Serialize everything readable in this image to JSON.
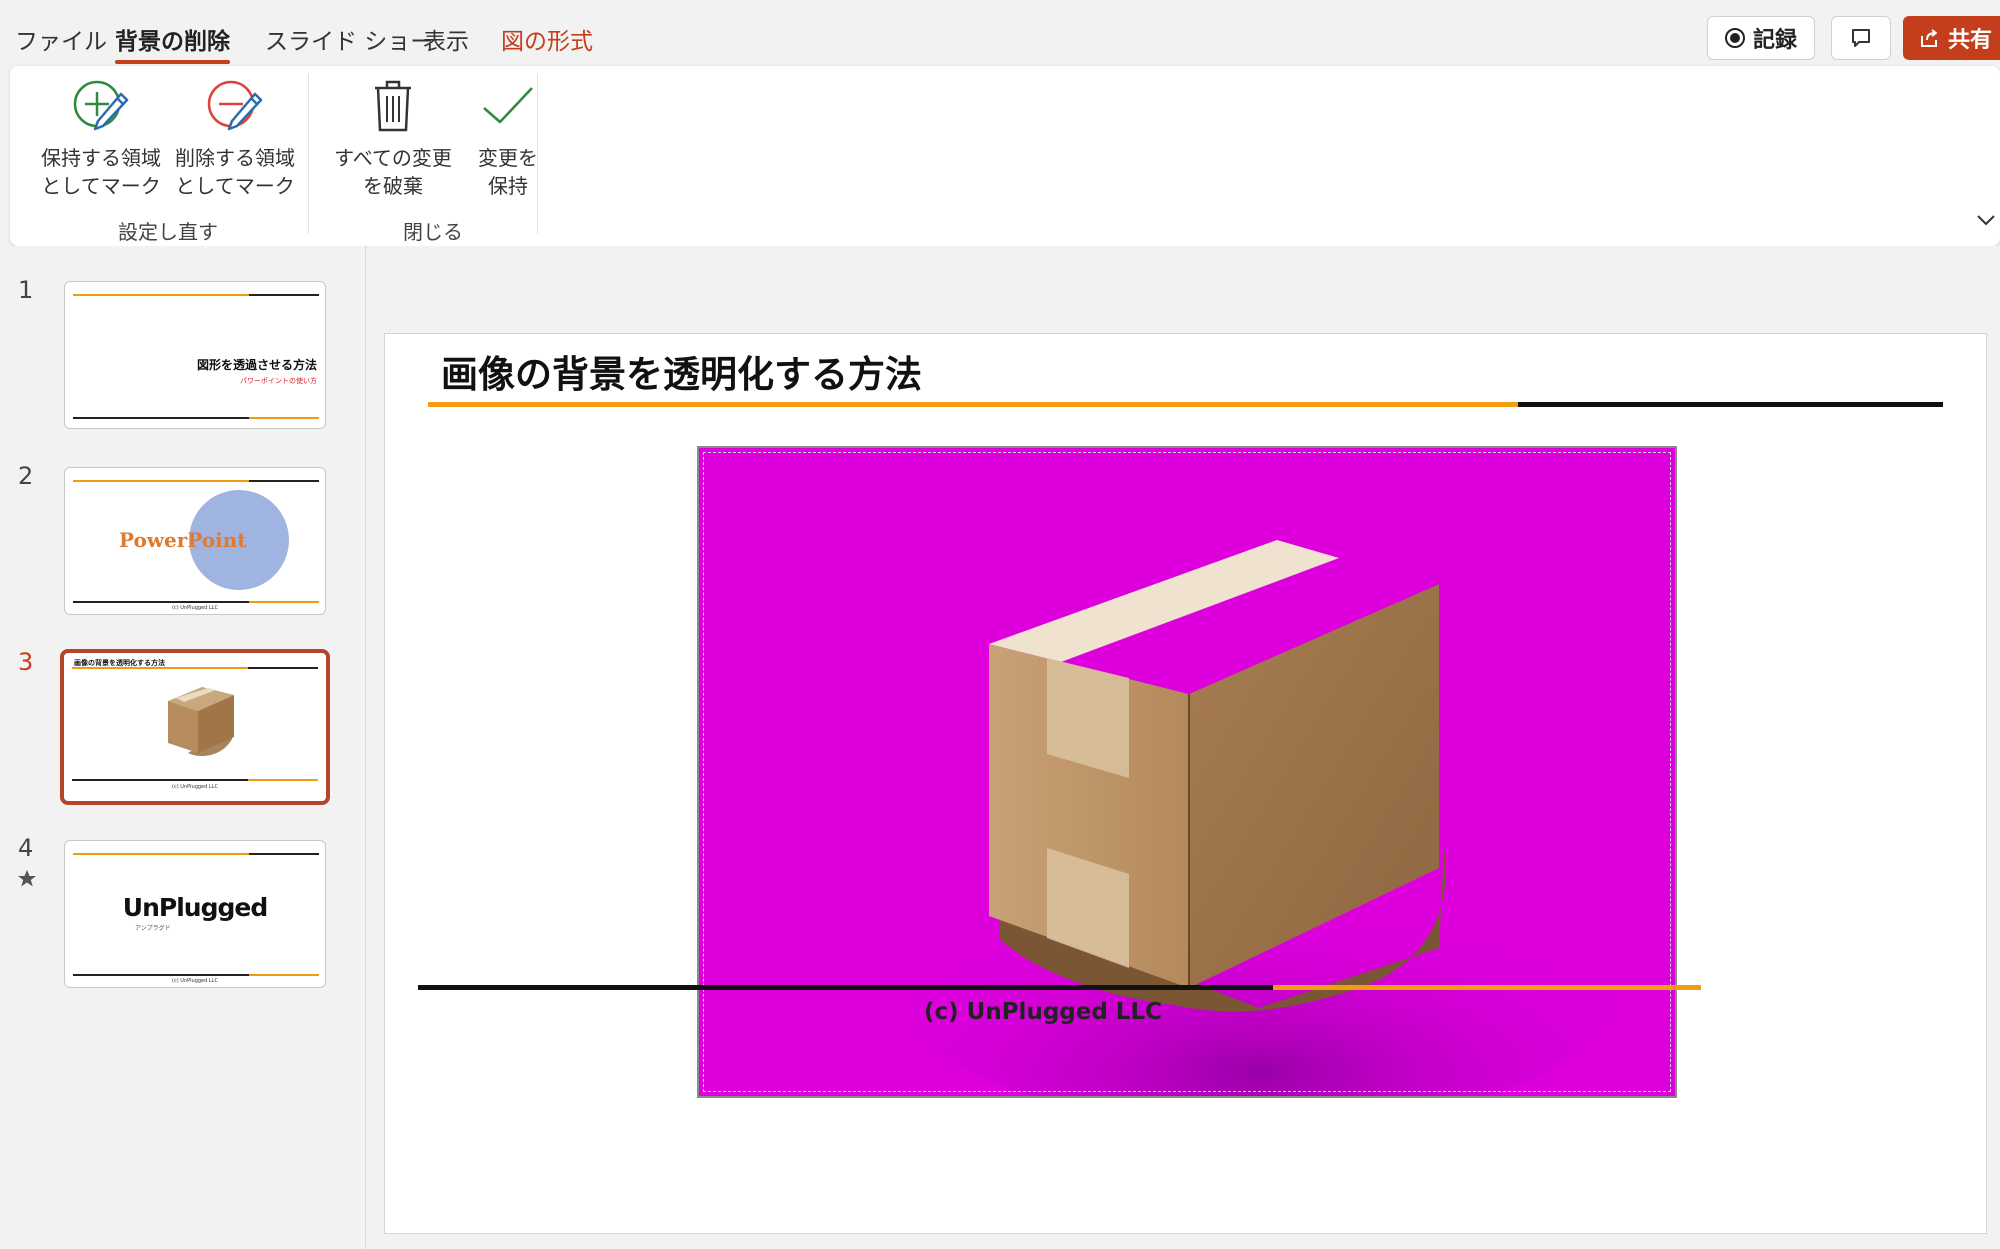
{
  "menu": {
    "tabs": [
      {
        "label": "ファイル"
      },
      {
        "label": "背景の削除"
      },
      {
        "label": "スライド ショー"
      },
      {
        "label": "表示"
      },
      {
        "label": "図の形式"
      }
    ],
    "record_label": "記録",
    "share_label": "共有"
  },
  "ribbon": {
    "buttons": [
      {
        "label": "保持する領域\nとしてマーク",
        "icon": "mark-keep-icon"
      },
      {
        "label": "削除する領域\nとしてマーク",
        "icon": "mark-remove-icon"
      },
      {
        "label": "すべての変更\nを破棄",
        "icon": "trash-icon"
      },
      {
        "label": "変更を\n保持",
        "icon": "checkmark-icon"
      }
    ],
    "groups": [
      {
        "label": "設定し直す"
      },
      {
        "label": "閉じる"
      }
    ]
  },
  "thumbnails": [
    {
      "number": "1",
      "title": "図形を透過させる方法",
      "subtitle": "パワーポイントの使い方"
    },
    {
      "number": "2",
      "title": "PowerPoint",
      "footer": "(c) UnPlugged LLC"
    },
    {
      "number": "3",
      "title": "画像の背景を透明化する方法",
      "footer": "(c) UnPlugged LLC"
    },
    {
      "number": "4",
      "logo": "UnPlugged",
      "logo_sub": "アンプラグド",
      "footer": "(c) UnPlugged LLC"
    }
  ],
  "slide": {
    "title": "画像の背景を透明化する方法",
    "footer": "(c) UnPlugged LLC"
  },
  "colors": {
    "accent": "#c43e1c",
    "orange_line": "#f39c12",
    "magenta_background": "#dd00dd",
    "selection_border": "#b4442a"
  }
}
